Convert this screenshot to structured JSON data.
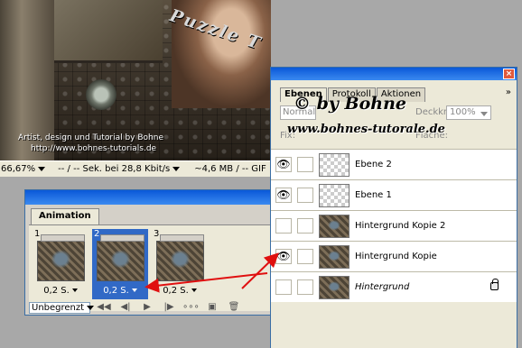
{
  "canvas": {
    "overlay_word": "Puzzle T",
    "credit_line1": "Artist, design und Tutorial by Bohne",
    "credit_line2": "http://www.bohnes-tutorials.de"
  },
  "statusbar": {
    "zoom": "66,67%",
    "timing": "-- / -- Sek. bei 28,8 Kbit/s",
    "filesize": "~4,6 MB / -- GIF"
  },
  "animation": {
    "tab_label": "Animation",
    "frames": [
      {
        "number": "1",
        "delay": "0,2 S."
      },
      {
        "number": "2",
        "delay": "0,2 S."
      },
      {
        "number": "3",
        "delay": "0,2 S."
      }
    ],
    "loop_value": "Unbegrenzt"
  },
  "layers_panel": {
    "tabs": [
      "Ebenen",
      "Protokoll",
      "Aktionen"
    ],
    "blend_mode": "Normal",
    "opacity_label": "Deckkraft:",
    "opacity_value": "100%",
    "fix_label": "Fix:",
    "fill_label": "Fläche:",
    "watermark_line1": "© by Bohne",
    "watermark_line2": "www.bohnes-tutorale.de",
    "layers": [
      {
        "name": "Ebene 2",
        "visible": true,
        "thumb": "transparent",
        "italic": false,
        "locked": false
      },
      {
        "name": "Ebene 1",
        "visible": true,
        "thumb": "transparent",
        "italic": false,
        "locked": false
      },
      {
        "name": "Hintergrund Kopie 2",
        "visible": false,
        "thumb": "image",
        "italic": false,
        "locked": false
      },
      {
        "name": "Hintergrund Kopie",
        "visible": true,
        "thumb": "image",
        "italic": false,
        "locked": false
      },
      {
        "name": "Hintergrund",
        "visible": false,
        "thumb": "image",
        "italic": true,
        "locked": true
      }
    ]
  },
  "colors": {
    "titlebar_blue": "#0a58d8",
    "selection_blue": "#3169c6",
    "arrow_red": "#e01010"
  }
}
